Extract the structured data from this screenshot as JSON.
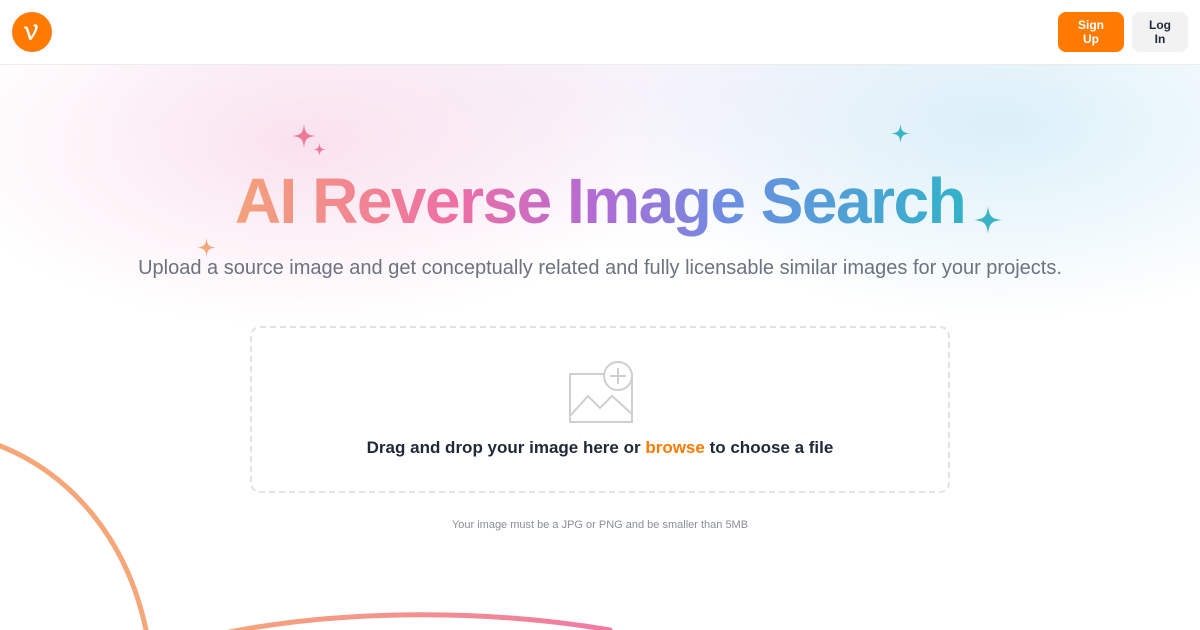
{
  "header": {
    "logo_icon": "vimeo-v-logo-icon",
    "signup_label": "Sign Up",
    "login_label": "Log In"
  },
  "hero": {
    "title": "AI Reverse Image Search",
    "subtitle": "Upload a source image and get conceptually related and fully licensable similar images for your projects."
  },
  "dropzone": {
    "icon": "image-add-icon",
    "text_before": "Drag and drop your image here or ",
    "browse_label": "browse",
    "text_after": " to choose a file"
  },
  "note": "Your image must be a JPG or PNG and be smaller than 5MB",
  "colors": {
    "brand_orange": "#ff7a00",
    "sparkle_pink": "#ee7a9a",
    "sparkle_orange": "#f3a77d",
    "sparkle_teal": "#3ab3c7"
  }
}
